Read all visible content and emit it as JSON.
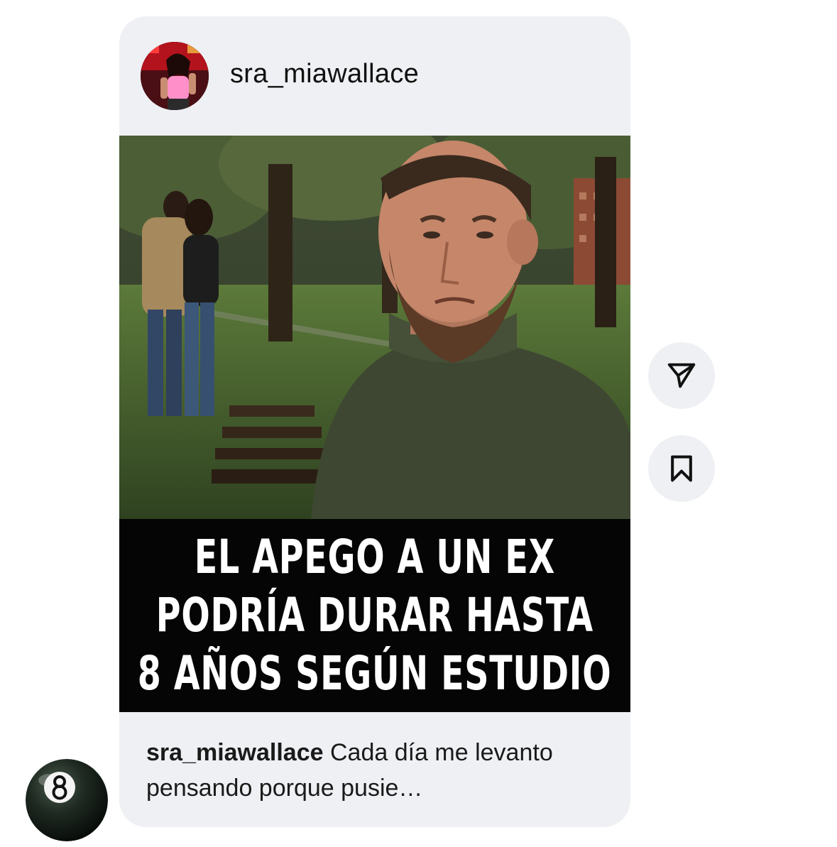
{
  "post": {
    "author": "sra_miawallace",
    "headline_lines": [
      "EL APEGO A UN EX",
      "PODRÍA DURAR HASTA",
      "8 AÑOS SEGÚN ESTUDIO"
    ],
    "caption_user": "sra_miawallace",
    "caption_text": " Cada día me levanto pensando porque pusie…"
  },
  "actions": {
    "share_icon": "paper-plane-icon",
    "save_icon": "bookmark-icon"
  },
  "sender": {
    "avatar_icon": "eight-ball-icon"
  },
  "colors": {
    "card_bg": "#eef0f3",
    "headline_bg": "#050505",
    "headline_text": "#ffffff"
  }
}
